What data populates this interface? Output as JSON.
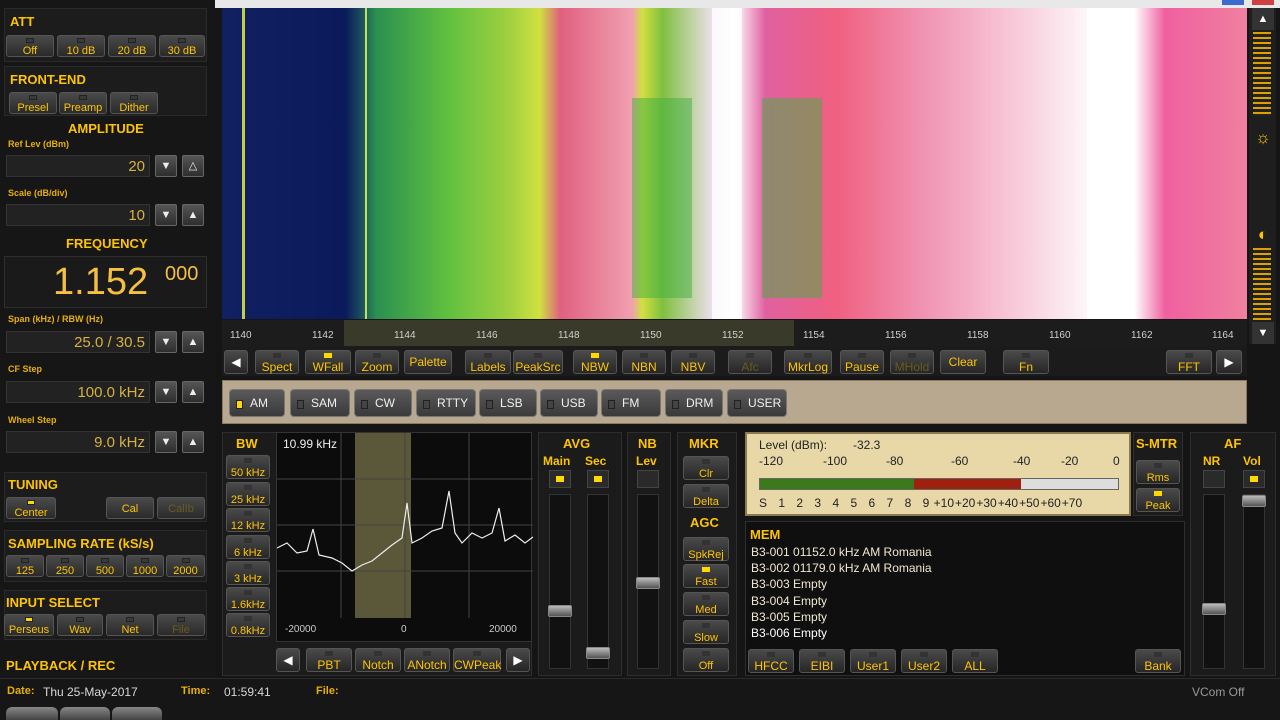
{
  "att": {
    "title": "ATT",
    "buttons": [
      {
        "label": "Off",
        "on": false
      },
      {
        "label": "10 dB",
        "on": false
      },
      {
        "label": "20 dB",
        "on": false
      },
      {
        "label": "30 dB",
        "on": false
      }
    ]
  },
  "frontend": {
    "title": "FRONT-END",
    "buttons": [
      {
        "label": "Presel",
        "on": false
      },
      {
        "label": "Preamp",
        "on": false
      },
      {
        "label": "Dither",
        "on": false
      }
    ]
  },
  "amplitude": {
    "title": "AMPLITUDE",
    "ref_label": "Ref Lev (dBm)",
    "ref_value": "20",
    "scale_label": "Scale (dB/div)",
    "scale_value": "10"
  },
  "frequency": {
    "title": "FREQUENCY",
    "main": "1.152",
    "sub": "000",
    "span_label": "Span (kHz) / RBW (Hz)",
    "span_value": "25.0 / 30.5",
    "cfstep_label": "CF Step",
    "cfstep_value": "100.0 kHz",
    "wheel_label": "Wheel Step",
    "wheel_value": "9.0 kHz"
  },
  "tuning": {
    "title": "TUNING",
    "center": "Center",
    "cal": "Cal",
    "calib": "CalIb"
  },
  "sampling": {
    "title": "SAMPLING RATE (kS/s)",
    "buttons": [
      "125",
      "250",
      "500",
      "1000",
      "2000"
    ]
  },
  "input": {
    "title": "INPUT SELECT",
    "buttons": [
      "Perseus",
      "Wav",
      "Net",
      "File"
    ]
  },
  "playback": {
    "title": "PLAYBACK / REC"
  },
  "status": {
    "date_label": "Date:",
    "date_value": "Thu 25-May-2017",
    "time_label": "Time:",
    "time_value": "01:59:41",
    "file_label": "File:",
    "vcom": "VCom Off"
  },
  "freq_axis": [
    "1140",
    "1142",
    "1144",
    "1146",
    "1148",
    "1150",
    "1152",
    "1154",
    "1156",
    "1158",
    "1160",
    "1162",
    "1164"
  ],
  "toolbar": [
    "Spect",
    "WFall",
    "Zoom",
    "Palette",
    "Labels",
    "PeakSrc",
    "NBW",
    "NBN",
    "NBV",
    "Afc",
    "MkrLog",
    "Pause",
    "MHold",
    "Clear",
    "Fn",
    "FFT"
  ],
  "modes": [
    {
      "label": "AM",
      "on": true
    },
    {
      "label": "SAM",
      "on": false
    },
    {
      "label": "CW",
      "on": false
    },
    {
      "label": "RTTY",
      "on": false
    },
    {
      "label": "LSB",
      "on": false
    },
    {
      "label": "USB",
      "on": false
    },
    {
      "label": "FM",
      "on": false
    },
    {
      "label": "DRM",
      "on": false
    },
    {
      "label": "USER",
      "on": false
    }
  ],
  "bw": {
    "title": "BW",
    "buttons": [
      "50 kHz",
      "25 kHz",
      "12 kHz",
      "6 kHz",
      "3 kHz",
      "1.6kHz",
      "0.8kHz"
    ],
    "readout": "10.99 kHz",
    "ticks": [
      "-20000",
      "0",
      "20000"
    ]
  },
  "filter_buttons": [
    "PBT",
    "Notch",
    "ANotch",
    "CWPeak"
  ],
  "avg": {
    "title": "AVG",
    "main": "Main",
    "sec": "Sec"
  },
  "nb": {
    "title": "NB",
    "lev": "Lev"
  },
  "mkr": {
    "title": "MKR",
    "clr": "Clr",
    "delta": "Delta"
  },
  "agc": {
    "title": "AGC",
    "buttons": [
      "SpkRej",
      "Fast",
      "Med",
      "Slow",
      "Off"
    ]
  },
  "level": {
    "label": "Level (dBm):",
    "value": "-32.3",
    "dbm_scale": [
      "-120",
      "-100",
      "-80",
      "-60",
      "-40",
      "-20",
      "0"
    ],
    "s_scale": [
      "S",
      "1",
      "2",
      "3",
      "4",
      "5",
      "6",
      "7",
      "8",
      "9",
      "+10",
      "+20",
      "+30",
      "+40",
      "+50",
      "+60",
      "+70"
    ],
    "level_fraction": 0.73
  },
  "smtr": {
    "title": "S-MTR",
    "rms": "Rms",
    "peak": "Peak"
  },
  "af": {
    "title": "AF",
    "nr": "NR",
    "vol": "Vol"
  },
  "mem": {
    "title": "MEM",
    "lines": [
      "B3-001 01152.0 kHz  AM  Romania",
      "B3-002 01179.0 kHz  AM  Romania",
      "B3-003 Empty",
      "B3-004 Empty",
      "B3-005 Empty",
      "B3-006 Empty"
    ],
    "buttons": [
      "HFCC",
      "EIBI",
      "User1",
      "User2",
      "ALL",
      "Bank"
    ]
  }
}
